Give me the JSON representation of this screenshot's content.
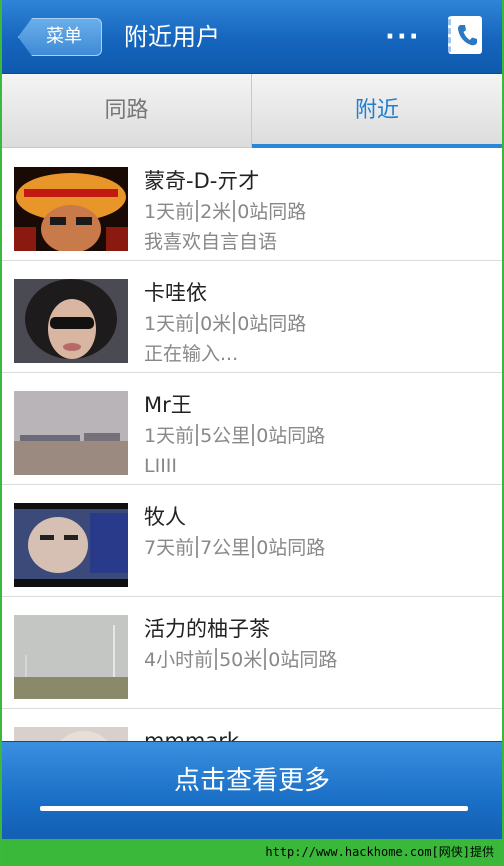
{
  "header": {
    "back_label": "菜单",
    "title": "附近用户",
    "dots": "···"
  },
  "tabs": [
    {
      "label": "同路",
      "active": false
    },
    {
      "label": "附近",
      "active": true
    }
  ],
  "users": [
    {
      "name": "蒙奇-D-亓才",
      "time": "1天前",
      "distance": "2米",
      "route": "0站同路",
      "signature": "我喜欢自言自语"
    },
    {
      "name": "卡哇依",
      "time": "1天前",
      "distance": "0米",
      "route": "0站同路",
      "signature": "正在输入..."
    },
    {
      "name": "Mr王",
      "time": "1天前",
      "distance": "5公里",
      "route": "0站同路",
      "signature": "LIIII"
    },
    {
      "name": "牧人",
      "time": "7天前",
      "distance": "7公里",
      "route": "0站同路",
      "signature": ""
    },
    {
      "name": "活力的柚子茶",
      "time": "4小时前",
      "distance": "50米",
      "route": "0站同路",
      "signature": ""
    },
    {
      "name": "mmmark",
      "time": "",
      "distance": "",
      "route": "",
      "signature": ""
    }
  ],
  "more_button": "点击查看更多",
  "footer": "http://www.hackhome.com[网侠]提供",
  "colors": {
    "accent": "#1f7fd1",
    "header": "#1565bd",
    "footer": "#3ab83a"
  }
}
